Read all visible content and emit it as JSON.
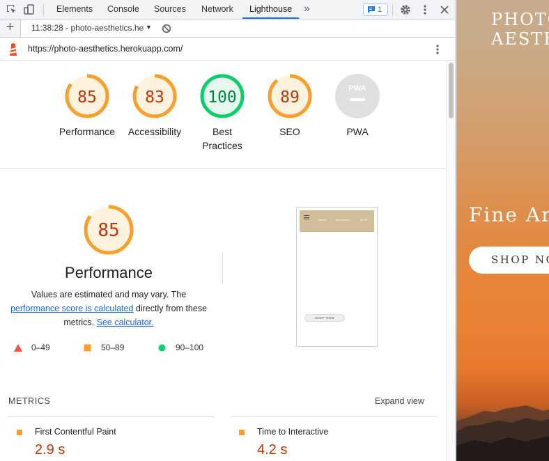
{
  "devtools": {
    "tabs": [
      "Elements",
      "Console",
      "Sources",
      "Network",
      "Lighthouse"
    ],
    "active_tab": "Lighthouse",
    "more_tabs_label": "»",
    "message_count": "1",
    "report_selector": "11:38:28 - photo-aesthetics.he",
    "url": "https://photo-aesthetics.herokuapp.com/"
  },
  "scores": [
    {
      "label": "Performance",
      "value": "85",
      "score": 85,
      "status": "average"
    },
    {
      "label": "Accessibility",
      "value": "83",
      "score": 83,
      "status": "average"
    },
    {
      "label": "Best\nPractices",
      "label_line1": "Best",
      "label_line2": "Practices",
      "value": "100",
      "score": 100,
      "status": "pass"
    },
    {
      "label": "SEO",
      "value": "89",
      "score": 89,
      "status": "average"
    },
    {
      "label": "PWA",
      "value": "PWA",
      "status": "na"
    }
  ],
  "performance": {
    "score": "85",
    "score_value": 85,
    "title": "Performance",
    "desc_prefix": "Values are estimated and may vary. The ",
    "desc_link1": "performance score is calculated",
    "desc_middle": " directly from these metrics. ",
    "desc_link2": "See calculator."
  },
  "legend": {
    "fail": "0–49",
    "average": "50–89",
    "pass": "90–100"
  },
  "screenshot": {
    "nav_links": [
      "Search",
      "My Account",
      "$0.00"
    ],
    "shop_button": "SHOP NOW"
  },
  "metrics": {
    "heading": "METRICS",
    "expand_label": "Expand view",
    "items": [
      {
        "name": "First Contentful Paint",
        "value": "2.9 s"
      },
      {
        "name": "Time to Interactive",
        "value": "4.2 s"
      }
    ]
  },
  "site": {
    "brand_line1": "PHOTO",
    "brand_line2": "AESTH",
    "tagline": "Fine Art",
    "shop_button": "SHOP NOW"
  },
  "colors": {
    "average": "#fa9f2c",
    "average_text": "#c33300",
    "average_bg": "#fff3e0",
    "pass": "#0cce6b",
    "pass_text": "#018642",
    "pass_bg": "#e6f8ee",
    "fail": "#ff4e42",
    "na": "#e0e0e0",
    "link": "#1a63d8",
    "active_tab": "#1a73e8"
  }
}
